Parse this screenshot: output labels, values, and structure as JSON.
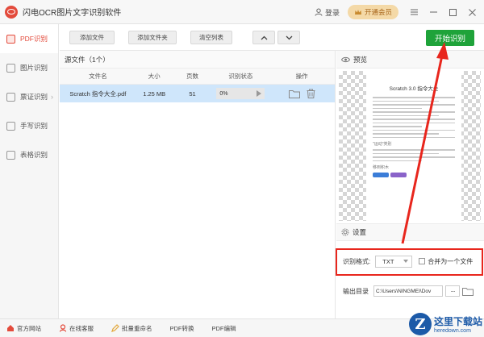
{
  "app": {
    "title": "闪电OCR图片文字识别软件"
  },
  "titlebar": {
    "login_label": "登录",
    "vip_label": "开通会员"
  },
  "sidebar": {
    "items": [
      {
        "label": "PDF识别",
        "active": true
      },
      {
        "label": "图片识别",
        "active": false
      },
      {
        "label": "票证识别",
        "active": false,
        "has_arrow": true
      },
      {
        "label": "手写识别",
        "active": false
      },
      {
        "label": "表格识别",
        "active": false
      }
    ]
  },
  "toolbar": {
    "add_file": "添加文件",
    "add_folder": "添加文件夹",
    "clear_list": "清空列表",
    "start": "开始识别"
  },
  "filelist": {
    "header": "源文件（1个）",
    "columns": [
      "文件名",
      "大小",
      "页数",
      "识别状态",
      "操作"
    ],
    "rows": [
      {
        "name": "Scratch 指令大全.pdf",
        "size": "1.25 MB",
        "pages": "51",
        "progress": "0%"
      }
    ]
  },
  "preview": {
    "title": "预览",
    "doc_title": "Scratch 3.0 指令大全",
    "subheads": [
      "\"运动\"类别",
      "移到积木"
    ]
  },
  "settings": {
    "title": "设置",
    "format_label": "识别格式:",
    "format_value": "TXT",
    "merge_label": "合并为一个文件",
    "merge_checked": false,
    "output_label": "输出目录",
    "output_path": "C:\\Users\\NINGMEI\\Dov",
    "browse_label": "···"
  },
  "footer": {
    "items": [
      "官方网站",
      "在线客服",
      "批量重命名",
      "PDF转换",
      "PDF编辑"
    ]
  },
  "watermark": {
    "logo_letter": "Z",
    "cn": "这里下载站",
    "en": "heredown.com"
  },
  "colors": {
    "accent_red": "#e34b3c",
    "start_green": "#1fa33a",
    "selected_row": "#cfe6fb",
    "highlight_red": "#e8261d"
  }
}
